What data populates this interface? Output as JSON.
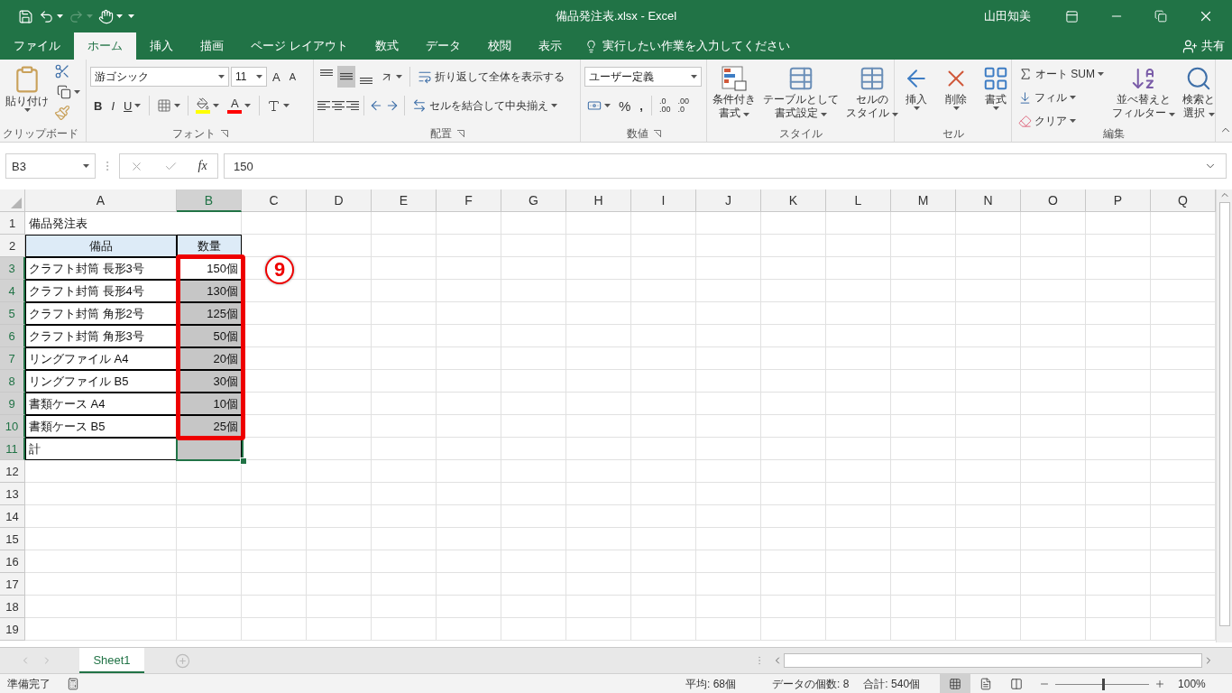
{
  "title_bar": {
    "title": "備品発注表.xlsx  -  Excel",
    "user": "山田知美",
    "redo_disabled": true
  },
  "tabs": [
    {
      "label": "ファイル",
      "selected": false
    },
    {
      "label": "ホーム",
      "selected": true
    },
    {
      "label": "挿入",
      "selected": false
    },
    {
      "label": "描画",
      "selected": false
    },
    {
      "label": "ページ レイアウト",
      "selected": false
    },
    {
      "label": "数式",
      "selected": false
    },
    {
      "label": "データ",
      "selected": false
    },
    {
      "label": "校閲",
      "selected": false
    },
    {
      "label": "表示",
      "selected": false
    }
  ],
  "tell_me": {
    "placeholder": "実行したい作業を入力してください"
  },
  "share": "共有",
  "ribbon": {
    "clipboard": {
      "label": "クリップボード",
      "paste": "貼り付け"
    },
    "font": {
      "label": "フォント",
      "font_name": "游ゴシック",
      "font_size": "11",
      "grow": "A",
      "shrink": "A",
      "bold": "B",
      "italic": "I",
      "underline": "U",
      "font_color": "A"
    },
    "alignment": {
      "label": "配置",
      "vertical_align": [
        {
          "selected": false
        },
        {
          "selected": true
        },
        {
          "selected": false
        }
      ],
      "wrap_text": "折り返して全体を表示する",
      "merge_center": "セルを結合して中央揃え"
    },
    "number": {
      "label": "数値",
      "format": "ユーザー定義",
      "percent": "%",
      "comma": ",",
      "increase_decimal": [
        ".0",
        ".00"
      ],
      "decrease_decimal": [
        ".00",
        ".0"
      ]
    },
    "styles": {
      "label": "スタイル",
      "buttons": [
        [
          "条件付き",
          "書式"
        ],
        [
          "テーブルとして",
          "書式設定"
        ],
        [
          "セルの",
          "スタイル"
        ]
      ]
    },
    "cells": {
      "label": "セル",
      "buttons": [
        "挿入",
        "削除",
        "書式"
      ]
    },
    "editing": {
      "label": "編集",
      "autosum": "オート SUM",
      "fill": "フィル",
      "clear": "クリア",
      "sort_filter": [
        "並べ替えと",
        "フィルター"
      ],
      "find_select": [
        "検索と",
        "選択"
      ]
    }
  },
  "formula_bar": {
    "name_box": "B3",
    "function_glyph": "fx",
    "formula": "150"
  },
  "sheet": {
    "columns": [
      {
        "letter": "A",
        "selected": false
      },
      {
        "letter": "B",
        "selected": true
      },
      {
        "letter": "C",
        "selected": false
      },
      {
        "letter": "D",
        "selected": false
      },
      {
        "letter": "E",
        "selected": false
      },
      {
        "letter": "F",
        "selected": false
      },
      {
        "letter": "G",
        "selected": false
      },
      {
        "letter": "H",
        "selected": false
      },
      {
        "letter": "I",
        "selected": false
      },
      {
        "letter": "J",
        "selected": false
      },
      {
        "letter": "K",
        "selected": false
      },
      {
        "letter": "L",
        "selected": false
      },
      {
        "letter": "M",
        "selected": false
      },
      {
        "letter": "N",
        "selected": false
      },
      {
        "letter": "O",
        "selected": false
      },
      {
        "letter": "P",
        "selected": false
      },
      {
        "letter": "Q",
        "selected": false
      }
    ],
    "rows": [
      {
        "number": "1",
        "kind": "title",
        "selected": false,
        "a": "備品発注表"
      },
      {
        "number": "2",
        "kind": "header",
        "selected": false,
        "a": "備品",
        "b": {
          "text": "数量",
          "selected": false,
          "active": false,
          "boxed": false
        }
      },
      {
        "number": "3",
        "kind": "item",
        "selected": true,
        "a": "クラフト封筒 長形3号",
        "b": {
          "text": "150個",
          "selected": true,
          "active": true,
          "boxed": true
        }
      },
      {
        "number": "4",
        "kind": "item",
        "selected": true,
        "a": "クラフト封筒 長形4号",
        "b": {
          "text": "130個",
          "selected": true,
          "active": false,
          "boxed": true
        }
      },
      {
        "number": "5",
        "kind": "item",
        "selected": true,
        "a": "クラフト封筒 角形2号",
        "b": {
          "text": "125個",
          "selected": true,
          "active": false,
          "boxed": true
        }
      },
      {
        "number": "6",
        "kind": "item",
        "selected": true,
        "a": "クラフト封筒 角形3号",
        "b": {
          "text": "50個",
          "selected": true,
          "active": false,
          "boxed": true
        }
      },
      {
        "number": "7",
        "kind": "item",
        "selected": true,
        "a": "リングファイル A4",
        "b": {
          "text": "20個",
          "selected": true,
          "active": false,
          "boxed": true
        }
      },
      {
        "number": "8",
        "kind": "item",
        "selected": true,
        "a": "リングファイル B5",
        "b": {
          "text": "30個",
          "selected": true,
          "active": false,
          "boxed": true
        }
      },
      {
        "number": "9",
        "kind": "item",
        "selected": true,
        "a": "書類ケース A4",
        "b": {
          "text": "10個",
          "selected": true,
          "active": false,
          "boxed": true
        }
      },
      {
        "number": "10",
        "kind": "item",
        "selected": true,
        "a": "書類ケース B5",
        "b": {
          "text": "25個",
          "selected": true,
          "active": false,
          "boxed": true
        }
      },
      {
        "number": "11",
        "kind": "total",
        "selected": true,
        "a": "計",
        "b": {
          "selected": true,
          "active": false,
          "boxed": false
        }
      },
      {
        "number": "12",
        "kind": "empty",
        "selected": false
      },
      {
        "number": "13",
        "kind": "empty",
        "selected": false
      },
      {
        "number": "14",
        "kind": "empty",
        "selected": false
      },
      {
        "number": "15",
        "kind": "empty",
        "selected": false
      },
      {
        "number": "16",
        "kind": "empty",
        "selected": false
      },
      {
        "number": "17",
        "kind": "empty",
        "selected": false
      },
      {
        "number": "18",
        "kind": "empty",
        "selected": false
      },
      {
        "number": "19",
        "kind": "empty",
        "selected": false
      }
    ],
    "callout": "9"
  },
  "sheet_tabs": [
    {
      "label": "Sheet1",
      "selected": true
    }
  ],
  "status_bar": {
    "ready": "準備完了",
    "stats": [
      "平均: 68個",
      "データの個数: 8",
      "合計: 540個"
    ],
    "views": [
      {
        "selected": true
      },
      {
        "selected": false
      },
      {
        "selected": false
      }
    ],
    "zoom": {
      "level": 0.5,
      "reading": "100%"
    }
  }
}
